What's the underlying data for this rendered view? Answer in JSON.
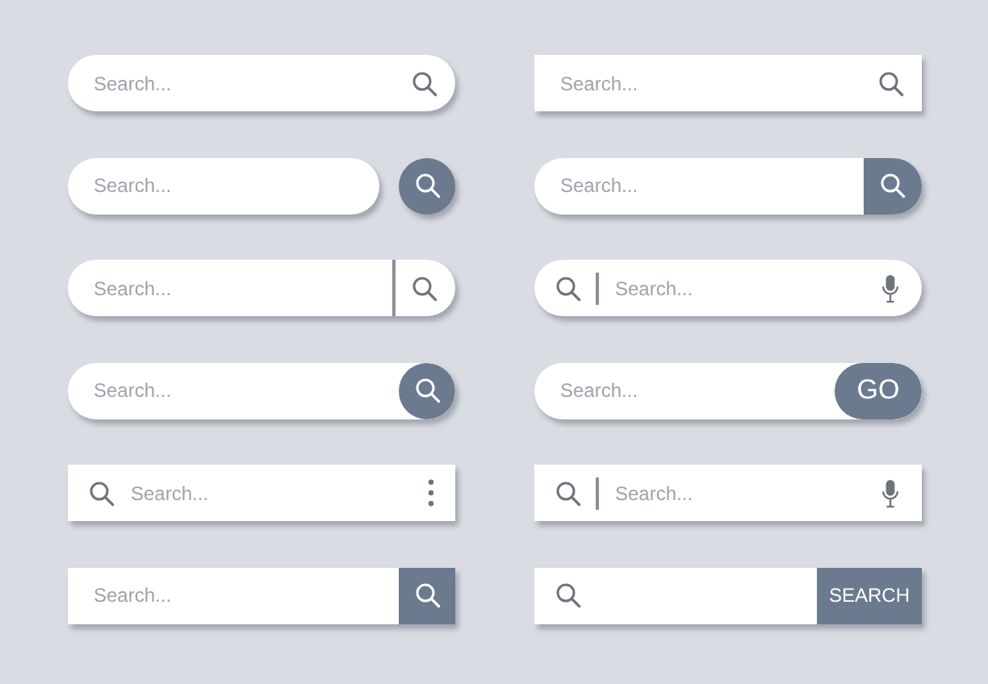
{
  "search_bars": [
    {
      "kind": "pill-icon",
      "placeholder": "Search..."
    },
    {
      "kind": "square-icon",
      "placeholder": "Search..."
    },
    {
      "kind": "pill-separate-button",
      "placeholder": "Search..."
    },
    {
      "kind": "pill-attached-button",
      "placeholder": "Search..."
    },
    {
      "kind": "pill-divider-icon",
      "placeholder": "Search..."
    },
    {
      "kind": "pill-mic",
      "placeholder": "Search..."
    },
    {
      "kind": "pill-circle-button",
      "placeholder": "Search..."
    },
    {
      "kind": "pill-text-button",
      "placeholder": "Search...",
      "button_label": "GO"
    },
    {
      "kind": "square-menu",
      "placeholder": "Search..."
    },
    {
      "kind": "square-mic",
      "placeholder": "Search..."
    },
    {
      "kind": "square-button",
      "placeholder": "Search..."
    },
    {
      "kind": "square-text-button",
      "button_label": "SEARCH"
    }
  ]
}
